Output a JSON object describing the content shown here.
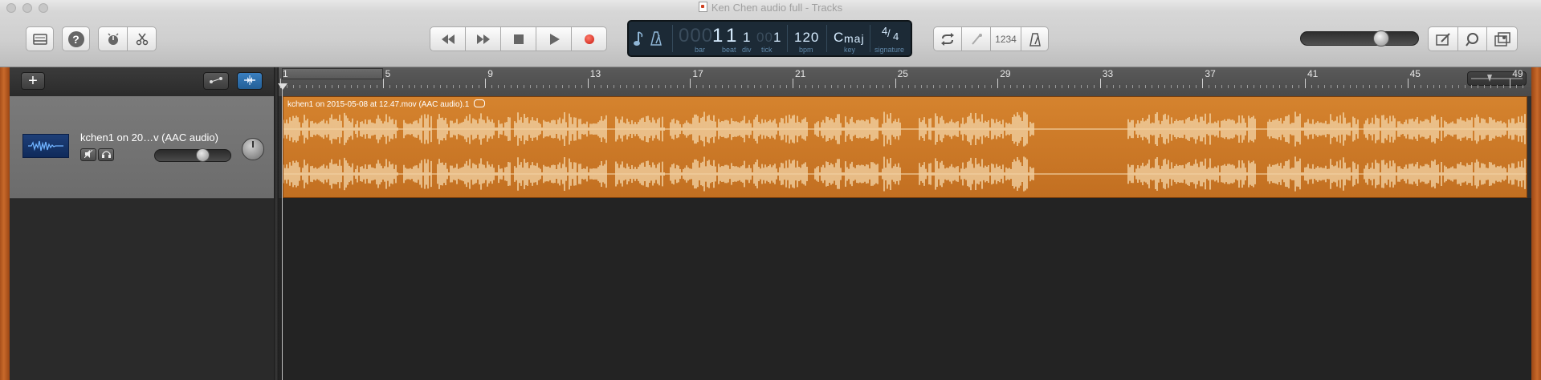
{
  "window": {
    "title": "Ken Chen audio full - Tracks"
  },
  "toolbar": {
    "library_icon": "library-icon",
    "help_label": "?",
    "smart_controls_icon": "smart-controls-icon",
    "editors_icon": "scissors-icon",
    "rewind_icon": "rewind-icon",
    "forward_icon": "fast-forward-icon",
    "stop_icon": "stop-icon",
    "play_icon": "play-icon",
    "record_icon": "record-icon",
    "cycle_icon": "cycle-icon",
    "tuner_icon": "tuner-icon",
    "count_in_label": "1234",
    "metronome_icon": "metronome-icon",
    "volume_level": 0.7,
    "notepad_icon": "notepad-icon",
    "loops_icon": "loops-icon",
    "media_icon": "media-browser-icon"
  },
  "lcd": {
    "bar_dim": "000",
    "bar": "1",
    "beat": "1",
    "div_dim": "1",
    "tick_dim": "00",
    "tick": "1",
    "tempo": "120",
    "key_root": "C",
    "key_mode": "maj",
    "sig_top": "4",
    "sig_bottom": "4",
    "labels": {
      "bar": "bar",
      "beat": "beat",
      "div": "div",
      "tick": "tick",
      "bpm": "bpm",
      "key": "key",
      "signature": "signature"
    }
  },
  "tracks_header": {
    "add_label": "+"
  },
  "track": {
    "name": "kchen1 on 20…v (AAC audio)",
    "volume_level": 0.65,
    "region_title": "kchen1 on 2015-05-08 at 12.47.mov (AAC audio).1"
  },
  "ruler": {
    "bars": [
      "1",
      "5",
      "9",
      "13",
      "17",
      "21",
      "25",
      "29",
      "33",
      "37",
      "41",
      "45",
      "49"
    ]
  },
  "colors": {
    "region": "#c97425",
    "waveform": "#f6dbb0",
    "lcd_bg": "#1c2a36"
  }
}
